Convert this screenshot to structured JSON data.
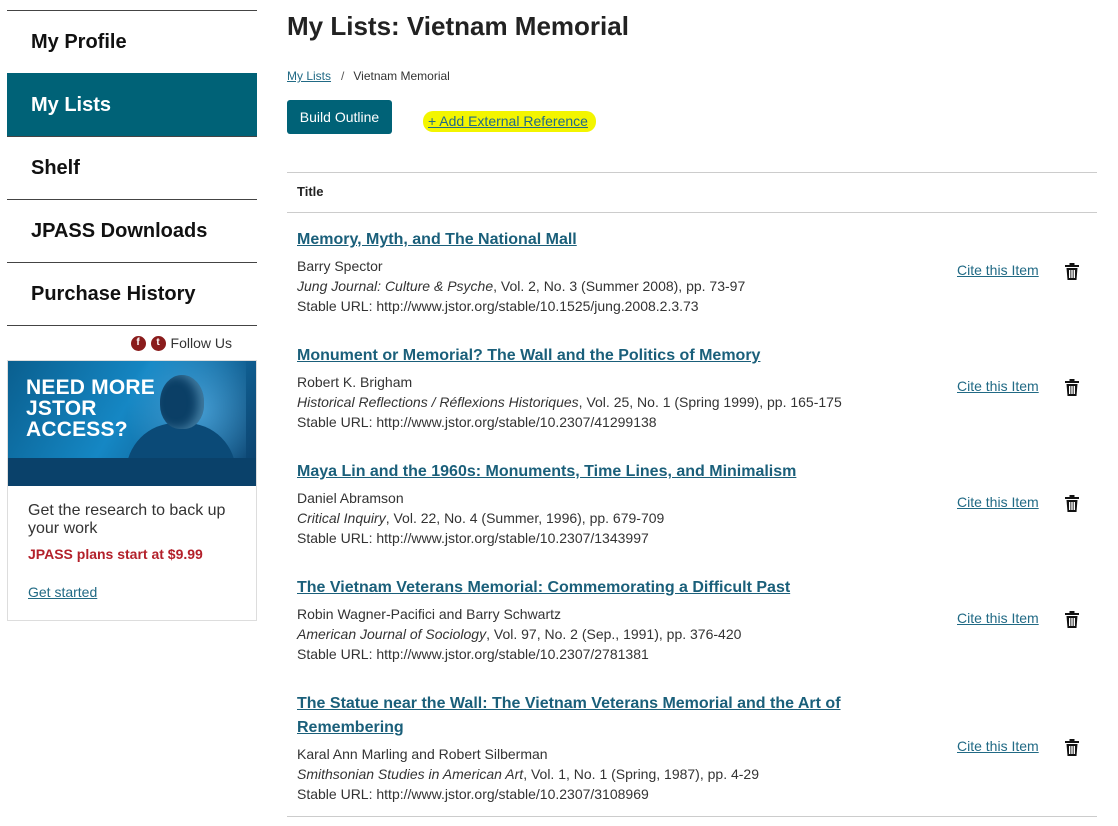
{
  "sidebar": {
    "items": [
      {
        "label": "My Profile",
        "active": false
      },
      {
        "label": "My Lists",
        "active": true
      },
      {
        "label": "Shelf",
        "active": false
      },
      {
        "label": "JPASS Downloads",
        "active": false
      },
      {
        "label": "Purchase History",
        "active": false
      }
    ],
    "follow_label": "Follow Us",
    "social_icons": [
      "facebook-icon",
      "twitter-icon"
    ]
  },
  "promo": {
    "headline": "NEED MORE\nJSTOR\nACCESS?",
    "text": "Get the research to back up your work",
    "price": "JPASS plans start at $9.99",
    "link": "Get started"
  },
  "page": {
    "title": "My Lists: Vietnam Memorial",
    "breadcrumb": {
      "link": "My Lists",
      "separator": "/",
      "current": "Vietnam Memorial"
    },
    "build_outline": "Build Outline",
    "add_reference": "+ Add External Reference",
    "table_header": "Title",
    "cite_label": "Cite this Item"
  },
  "items": [
    {
      "title": "Memory, Myth, and The National Mall",
      "authors": "Barry Spector",
      "journal": "Jung Journal: Culture & Psyche",
      "details": ", Vol. 2, No. 3 (Summer 2008), pp. 73-97",
      "stable": "Stable URL: http://www.jstor.org/stable/10.1525/jung.2008.2.3.73"
    },
    {
      "title": "Monument or Memorial? The Wall and the Politics of Memory",
      "authors": "Robert K. Brigham",
      "journal": "Historical Reflections / Réflexions Historiques",
      "details": ", Vol. 25, No. 1 (Spring 1999), pp. 165-175",
      "stable": "Stable URL: http://www.jstor.org/stable/10.2307/41299138"
    },
    {
      "title": "Maya Lin and the 1960s: Monuments, Time Lines, and Minimalism",
      "authors": "Daniel Abramson",
      "journal": "Critical Inquiry",
      "details": ", Vol. 22, No. 4 (Summer, 1996), pp. 679-709",
      "stable": "Stable URL: http://www.jstor.org/stable/10.2307/1343997"
    },
    {
      "title": "The Vietnam Veterans Memorial: Commemorating a Difficult Past",
      "authors": "Robin Wagner-Pacifici and Barry Schwartz",
      "journal": "American Journal of Sociology",
      "details": ", Vol. 97, No. 2 (Sep., 1991), pp. 376-420",
      "stable": "Stable URL: http://www.jstor.org/stable/10.2307/2781381"
    },
    {
      "title": "The Statue near the Wall: The Vietnam Veterans Memorial and the Art of Remembering",
      "authors": "Karal Ann Marling and Robert Silberman",
      "journal": "Smithsonian Studies in American Art",
      "details": ", Vol. 1, No. 1 (Spring, 1987), pp. 4-29",
      "stable": "Stable URL: http://www.jstor.org/stable/10.2307/3108969"
    }
  ],
  "colors": {
    "accent": "#006277",
    "link": "#216a85",
    "highlight": "#f3f500",
    "price": "#b3202a"
  }
}
